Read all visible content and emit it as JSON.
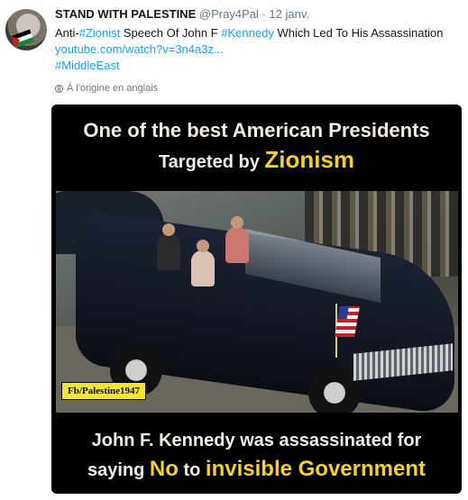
{
  "tweet": {
    "author_name": "STAND WITH PALESTINE",
    "author_handle": "@Pray4Pal",
    "separator": "·",
    "timestamp": "12 janv.",
    "text_prefix": "Anti-",
    "hashtag1": "#Zionist",
    "text_middle": " Speech Of John F ",
    "hashtag2": "#Kennedy",
    "text_suffix": " Which Led To His Assassination",
    "link": "youtube.com/watch?v=3n4a3z...",
    "hashtag3": "#MiddleEast",
    "translation_note": "À l'origine en anglais"
  },
  "media": {
    "headline_line1": "One of the best American Presidents",
    "headline_line2_prefix": "Targeted by ",
    "headline_line2_accent": "Zionism",
    "caption_line1": "John F. Kennedy was assassinated for",
    "caption_line2_a": "saying ",
    "caption_line2_b": "No",
    "caption_line2_c": " to ",
    "caption_line2_d": "invisible Government",
    "watermark": "Fb/Palestine1947"
  },
  "colors": {
    "link_blue": "#1da1f2",
    "accent_yellow": "#f5d21f",
    "watermark_yellow": "#f5e430"
  },
  "icons": {
    "translation": "globe-icon"
  }
}
